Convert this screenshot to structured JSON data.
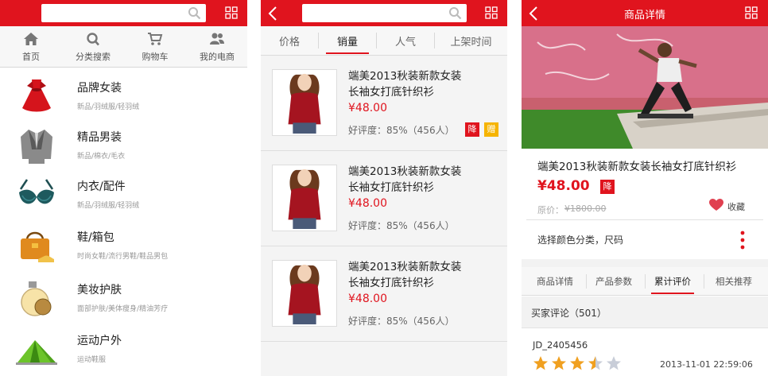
{
  "panel1": {
    "nav": [
      {
        "label": "首页",
        "icon": "home-icon"
      },
      {
        "label": "分类搜索",
        "icon": "search-icon"
      },
      {
        "label": "购物车",
        "icon": "cart-icon"
      },
      {
        "label": "我的电商",
        "icon": "user-icon"
      }
    ],
    "categories": [
      {
        "name": "品牌女装",
        "sub": "新品/羽绒服/轻羽绒",
        "icon": "dress-icon"
      },
      {
        "name": "精品男装",
        "sub": "新品/棉衣/毛衣",
        "icon": "jacket-icon"
      },
      {
        "name": "内衣/配件",
        "sub": "新品/羽绒服/轻羽绒",
        "icon": "bra-icon"
      },
      {
        "name": "鞋/箱包",
        "sub": "时尚女鞋/流行男鞋/鞋品男包",
        "icon": "bag-icon"
      },
      {
        "name": "美妆护肤",
        "sub": "面部护肤/美体瘦身/精油芳疗",
        "icon": "perfume-icon"
      },
      {
        "name": "运动户外",
        "sub": "运动鞋服",
        "icon": "tent-icon"
      }
    ]
  },
  "panel2": {
    "sort_tabs": [
      "价格",
      "销量",
      "人气",
      "上架时间"
    ],
    "active_sort": "销量",
    "products": [
      {
        "title_line1": "端美2013秋装新款女装",
        "title_line2": "长袖女打底针织衫",
        "price": "¥48.00",
        "rating": "好评度：85%（456人）",
        "tag1": "降",
        "tag2": "赠"
      },
      {
        "title_line1": "端美2013秋装新款女装",
        "title_line2": "长袖女打底针织衫",
        "price": "¥48.00",
        "rating": "好评度：85%（456人）"
      },
      {
        "title_line1": "端美2013秋装新款女装",
        "title_line2": "长袖女打底针织衫",
        "price": "¥48.00",
        "rating": "好评度：85%（456人）"
      }
    ]
  },
  "panel3": {
    "title": "商品详情",
    "product_title": "端美2013秋装新款女装长袖女打底针织衫",
    "price": "¥48.00",
    "price_badge": "降",
    "original_label": "原价：",
    "original_price": "¥1800.00",
    "favorite_label": "收藏",
    "spec_label": "选择颜色分类，尺码",
    "tabs": [
      "商品详情",
      "产品参数",
      "累计评价",
      "相关推荐"
    ],
    "active_tab": "累计评价",
    "review_header": "买家评论（501）",
    "reviewer": "JD_2405456",
    "review_date": "2013-11-01 22:59:06",
    "stars": 3.5
  },
  "colors": {
    "brand_red": "#e0141e",
    "star": "#f0a020"
  }
}
